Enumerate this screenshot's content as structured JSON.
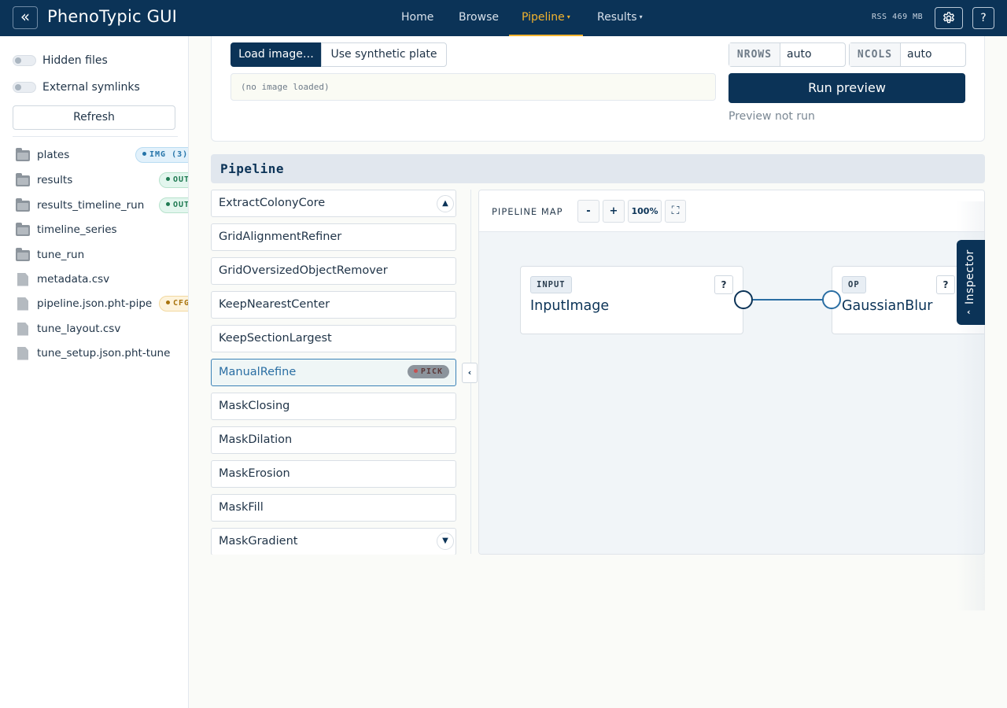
{
  "header": {
    "collapse_icon": "«",
    "title": "PhenoTypic GUI",
    "nav": [
      {
        "label": "Home"
      },
      {
        "label": "Browse"
      },
      {
        "label": "Pipeline",
        "caret": "▾"
      },
      {
        "label": "Results",
        "caret": "▾"
      }
    ],
    "rss": "RSS 469 MB",
    "settings_icon": "gear-icon",
    "help_label": "?",
    "accent_color": "#f2b32e",
    "brand_color": "#0b3357"
  },
  "sidebar": {
    "toggles": [
      {
        "label": "Hidden files"
      },
      {
        "label": "External symlinks"
      }
    ],
    "refresh_label": "Refresh",
    "files": [
      {
        "name": "plates",
        "type": "folder",
        "badge": "IMG (3)"
      },
      {
        "name": "results",
        "type": "folder",
        "badge": "OUT"
      },
      {
        "name": "results_timeline_run",
        "type": "folder",
        "badge": "OUT"
      },
      {
        "name": "timeline_series",
        "type": "folder"
      },
      {
        "name": "tune_run",
        "type": "folder"
      },
      {
        "name": "metadata.csv",
        "type": "file"
      },
      {
        "name": "pipeline.json.pht-pipe",
        "type": "file",
        "badge": "CFG"
      },
      {
        "name": "tune_layout.csv",
        "type": "file"
      },
      {
        "name": "tune_setup.json.pht-tune",
        "type": "file"
      }
    ]
  },
  "load": {
    "load_label": "Load image…",
    "synthetic_label": "Use synthetic plate",
    "image_status": "(no image loaded)",
    "nrows_label": "NROWS",
    "nrows_value": "auto",
    "ncols_label": "NCOLS",
    "ncols_value": "auto",
    "run_label": "Run preview",
    "preview_status": "Preview not run"
  },
  "pipeline": {
    "title": "Pipeline",
    "operations": [
      {
        "label": "ExtractColonyCore"
      },
      {
        "label": "GridAlignmentRefiner"
      },
      {
        "label": "GridOversizedObjectRemover"
      },
      {
        "label": "KeepNearestCenter"
      },
      {
        "label": "KeepSectionLargest"
      },
      {
        "label": "ManualRefine",
        "badge": "PICK",
        "selected": true
      },
      {
        "label": "MaskClosing"
      },
      {
        "label": "MaskDilation"
      },
      {
        "label": "MaskErosion"
      },
      {
        "label": "MaskFill"
      },
      {
        "label": "MaskGradient"
      }
    ],
    "collapse_icon": "‹",
    "map": {
      "title": "PIPELINE MAP",
      "zoom_out": "-",
      "zoom_in": "+",
      "zoom_level": "100%",
      "fullscreen_icon": "⛶",
      "nodes": [
        {
          "tag": "INPUT",
          "title": "InputImage",
          "help": "?"
        },
        {
          "tag": "OP",
          "title": "GaussianBlur",
          "help": "?"
        }
      ]
    },
    "inspector_label": "Inspector",
    "inspector_caret": "‹"
  }
}
